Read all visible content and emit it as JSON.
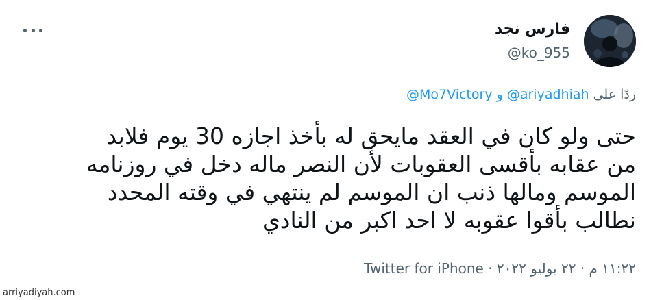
{
  "tweet": {
    "author": {
      "display_name": "فارس نجد",
      "handle": "@ko_955"
    },
    "reply": {
      "prefix": "ردًا على",
      "mention_1": "@ariyadhiah",
      "conjunction": "و",
      "mention_2": "@Mo7Victory"
    },
    "text_lines": [
      "حتى ولو كان في العقد مايحق له بأخذ اجازه 30 يوم فلابد",
      "من عقابه بأقسى العقوبات لأن النصر ماله دخل في روزنامه",
      "الموسم ومالها ذنب ان الموسم لم ينتهي في وقته المحدد",
      "نطالب بأقوا عقوبه لا احد اكبر من النادي"
    ],
    "meta": {
      "time": "١١:٢٢ م",
      "separator": "·",
      "date": "٢٢ يوليو ٢٠٢٢",
      "separator_2": "·",
      "source": "Twitter for iPhone"
    }
  },
  "watermark": "arriyadiyah.com",
  "icons": {
    "more": "more-horizontal-icon"
  },
  "colors": {
    "text_primary": "#0f1419",
    "text_secondary": "#536471",
    "link": "#1d9bf0"
  }
}
